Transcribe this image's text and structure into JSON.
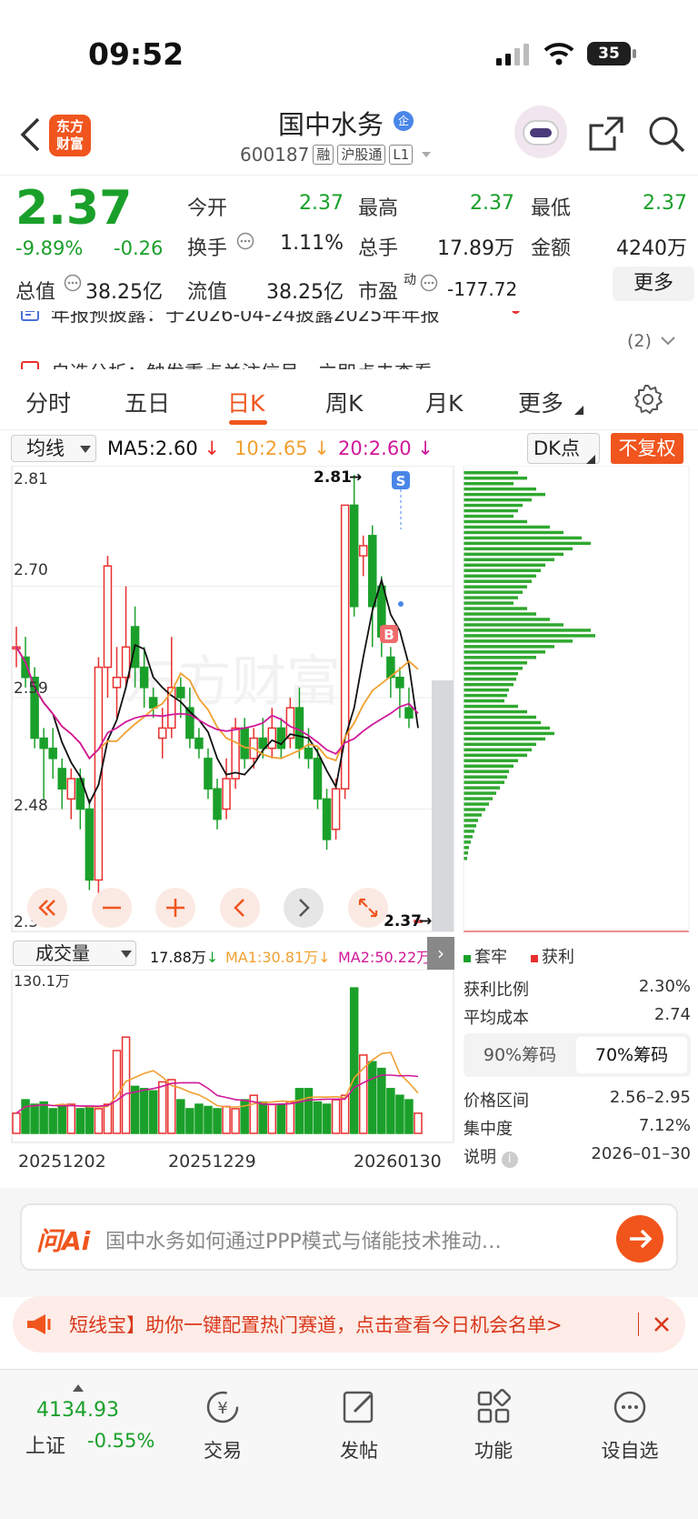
{
  "status_bar": {
    "time": "09:52",
    "battery": "35"
  },
  "header": {
    "logo_line1": "东方",
    "logo_line2": "财富",
    "stock_name": "国中水务",
    "name_badge": "企",
    "code": "600187",
    "tags": [
      "融",
      "沪股通",
      "L1"
    ]
  },
  "quote": {
    "price": "2.37",
    "change_pct": "-9.89%",
    "change": "-0.26",
    "open_label": "今开",
    "open": "2.37",
    "high_label": "最高",
    "high": "2.37",
    "low_label": "最低",
    "low": "2.37",
    "turnover_label": "换手",
    "turnover": "1.11%",
    "volume_label": "总手",
    "volume": "17.89万",
    "amount_label": "金额",
    "amount": "4240万",
    "mktcap_label": "总值",
    "mktcap": "38.25亿",
    "float_label": "流值",
    "float_cap": "38.25亿",
    "pe_label": "市盈",
    "pe_sup": "动",
    "pe": "-177.72",
    "more": "更多"
  },
  "notice": {
    "line1": "年报预披露：于2026-04-24披露2025年年报",
    "line2": "自选分析：触发重点关注信号，立即点击查看",
    "count": "(2)"
  },
  "tabs": [
    "分时",
    "五日",
    "日K",
    "周K",
    "月K",
    "更多"
  ],
  "active_tab": "日K",
  "ma": {
    "select": "均线",
    "ma5": "MA5:2.60",
    "ma10": "10:2.65",
    "ma20": "20:2.60",
    "dk": "DK点",
    "fq": "不复权"
  },
  "kline": {
    "y_ticks": [
      "2.81",
      "2.70",
      "2.59",
      "2.48",
      "2.37"
    ],
    "high_mark": "2.81",
    "low_mark": "2.37",
    "sell_mark": "S",
    "buy_mark": "B",
    "watermark": "东方财富"
  },
  "chart_data": {
    "type": "candlestick",
    "ylim": [
      2.37,
      2.81
    ],
    "candles": [
      [
        2.64,
        2.64,
        2.66,
        2.62
      ],
      [
        2.63,
        2.61,
        2.65,
        2.6
      ],
      [
        2.61,
        2.55,
        2.62,
        2.54
      ],
      [
        2.55,
        2.54,
        2.56,
        2.49
      ],
      [
        2.54,
        2.53,
        2.56,
        2.51
      ],
      [
        2.52,
        2.5,
        2.53,
        2.48
      ],
      [
        2.49,
        2.51,
        2.52,
        2.47
      ],
      [
        2.51,
        2.48,
        2.52,
        2.46
      ],
      [
        2.48,
        2.41,
        2.49,
        2.4
      ],
      [
        2.41,
        2.62,
        2.63,
        2.39
      ],
      [
        2.62,
        2.72,
        2.73,
        2.59
      ],
      [
        2.6,
        2.61,
        2.64,
        2.57
      ],
      [
        2.61,
        2.64,
        2.7,
        2.6
      ],
      [
        2.66,
        2.62,
        2.68,
        2.6
      ],
      [
        2.62,
        2.6,
        2.64,
        2.58
      ],
      [
        2.59,
        2.58,
        2.6,
        2.57
      ],
      [
        2.55,
        2.56,
        2.58,
        2.53
      ],
      [
        2.56,
        2.6,
        2.65,
        2.55
      ],
      [
        2.6,
        2.59,
        2.61,
        2.57
      ],
      [
        2.58,
        2.55,
        2.6,
        2.54
      ],
      [
        2.55,
        2.54,
        2.56,
        2.53
      ],
      [
        2.53,
        2.5,
        2.54,
        2.49
      ],
      [
        2.5,
        2.47,
        2.51,
        2.46
      ],
      [
        2.48,
        2.51,
        2.53,
        2.47
      ],
      [
        2.51,
        2.56,
        2.57,
        2.5
      ],
      [
        2.56,
        2.53,
        2.57,
        2.52
      ],
      [
        2.53,
        2.55,
        2.56,
        2.52
      ],
      [
        2.55,
        2.54,
        2.57,
        2.53
      ],
      [
        2.54,
        2.56,
        2.58,
        2.53
      ],
      [
        2.56,
        2.54,
        2.57,
        2.53
      ],
      [
        2.55,
        2.58,
        2.59,
        2.54
      ],
      [
        2.58,
        2.54,
        2.6,
        2.53
      ],
      [
        2.54,
        2.53,
        2.56,
        2.52
      ],
      [
        2.53,
        2.49,
        2.54,
        2.48
      ],
      [
        2.49,
        2.45,
        2.5,
        2.44
      ],
      [
        2.46,
        2.5,
        2.51,
        2.45
      ],
      [
        2.5,
        2.78,
        2.78,
        2.49
      ],
      [
        2.78,
        2.68,
        2.81,
        2.67
      ],
      [
        2.73,
        2.74,
        2.75,
        2.71
      ],
      [
        2.75,
        2.68,
        2.76,
        2.64
      ],
      [
        2.7,
        2.65,
        2.71,
        2.63
      ],
      [
        2.63,
        2.61,
        2.64,
        2.59
      ],
      [
        2.61,
        2.6,
        2.62,
        2.57
      ],
      [
        2.58,
        2.57,
        2.6,
        2.56
      ],
      [
        2.37,
        2.37,
        2.37,
        2.37
      ]
    ],
    "volume": {
      "ylim_label": "130.1万",
      "x_labels": [
        "20251202",
        "20251229",
        "20260130"
      ],
      "latest": "17.88万",
      "ma1": "MA1:30.81万",
      "ma2": "MA2:50.22万",
      "select": "成交量"
    }
  },
  "chip": {
    "legend_trap": "套牢",
    "legend_profit": "获利",
    "profit_ratio_label": "获利比例",
    "profit_ratio": "2.30%",
    "avg_cost_label": "平均成本",
    "avg_cost": "2.74",
    "tab90": "90%筹码",
    "tab70": "70%筹码",
    "range_label": "价格区间",
    "range": "2.56–2.95",
    "conc_label": "集中度",
    "conc": "7.12%",
    "note_label": "说明",
    "note_date": "2026–01–30"
  },
  "ai": {
    "logo": "问Ai",
    "placeholder": "国中水务如何通过PPP模式与储能技术推动…"
  },
  "promo": {
    "text": "短线宝】助你一键配置热门赛道，点击查看今日机会名单>"
  },
  "bottom_nav": {
    "index_value": "4134.93",
    "index_name": "上证",
    "index_change": "-0.55%",
    "items": [
      "交易",
      "发帖",
      "功能",
      "设自选"
    ]
  }
}
